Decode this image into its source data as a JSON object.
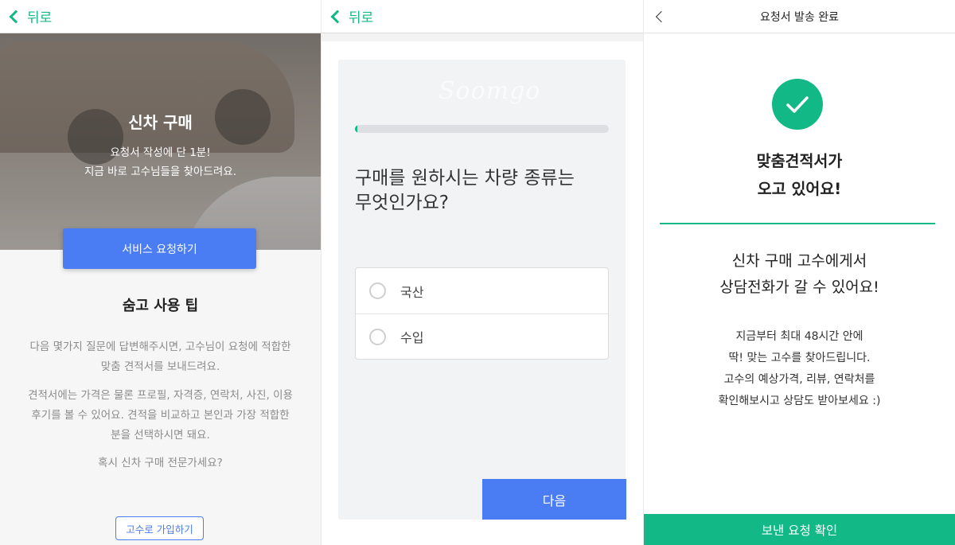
{
  "screen1": {
    "back_label": "뒤로",
    "hero_title": "신차 구매",
    "hero_sub_line1": "요청서 작성에 단 1분!",
    "hero_sub_line2": "지금 바로 고수님들을 찾아드려요.",
    "cta_label": "서비스 요청하기",
    "tips_title": "숨고 사용 팁",
    "tips_p1_line1": "다음 몇가지 질문에 답변해주시면, 고수님이 요청에 적합한",
    "tips_p1_line2": "맞춤 견적서를 보내드려요.",
    "tips_p2_line1": "견적서에는 가격은 물론 프로필, 자격증, 연락처, 사진, 이용",
    "tips_p2_line2": "후기를 볼 수 있어요. 견적을 비교하고 본인과 가장 적합한",
    "tips_p2_line3": "분을 선택하시면 돼요.",
    "tips_p3": "혹시 신차 구매 전문가세요?",
    "join_label": "고수로 가입하기"
  },
  "screen2": {
    "back_label": "뒤로",
    "watermark": "Soomgo",
    "progress_fraction": 0.01,
    "question_line1": "구매를 원하시는 차량 종류는",
    "question_line2": "무엇인가요?",
    "options": [
      "국산",
      "수입"
    ],
    "next_label": "다음"
  },
  "screen3": {
    "title": "요청서 발송 완료",
    "done_line1": "맞춤견적서가",
    "done_line2": "오고 있어요!",
    "msg_line1": "신차 구매 고수에게서",
    "msg_line2": "상담전화가 갈 수 있어요!",
    "info_line1": "지금부터 최대 48시간 안에",
    "info_line2": "딱! 맞는 고수를 찾아드립니다.",
    "info_line3": "고수의 예상가격, 리뷰, 연락처를",
    "info_line4": "확인해보시고 상담도 받아보세요 :)",
    "confirm_label": "보낸 요청 확인"
  },
  "colors": {
    "accent_green": "#12b886",
    "accent_blue": "#4a7cf3"
  }
}
